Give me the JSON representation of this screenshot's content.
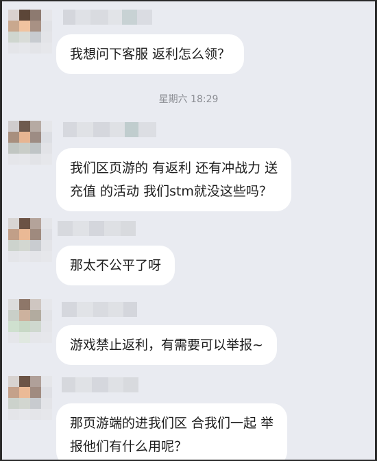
{
  "timestamp": "星期六 18:29",
  "messages": [
    {
      "lines": [
        "我想问下客服 返利怎么领？"
      ]
    },
    {
      "lines": [
        "我们区页游的 有返利 还有冲战力 送",
        "充值 的活动 我们stm就没这些吗？"
      ]
    },
    {
      "lines": [
        "那太不公平了呀"
      ]
    },
    {
      "lines": [
        "游戏禁止返利，有需要可以举报~"
      ]
    },
    {
      "lines": [
        "那页游端的进我们区 合我们一起 举",
        "报他们有什么用呢？"
      ]
    }
  ]
}
